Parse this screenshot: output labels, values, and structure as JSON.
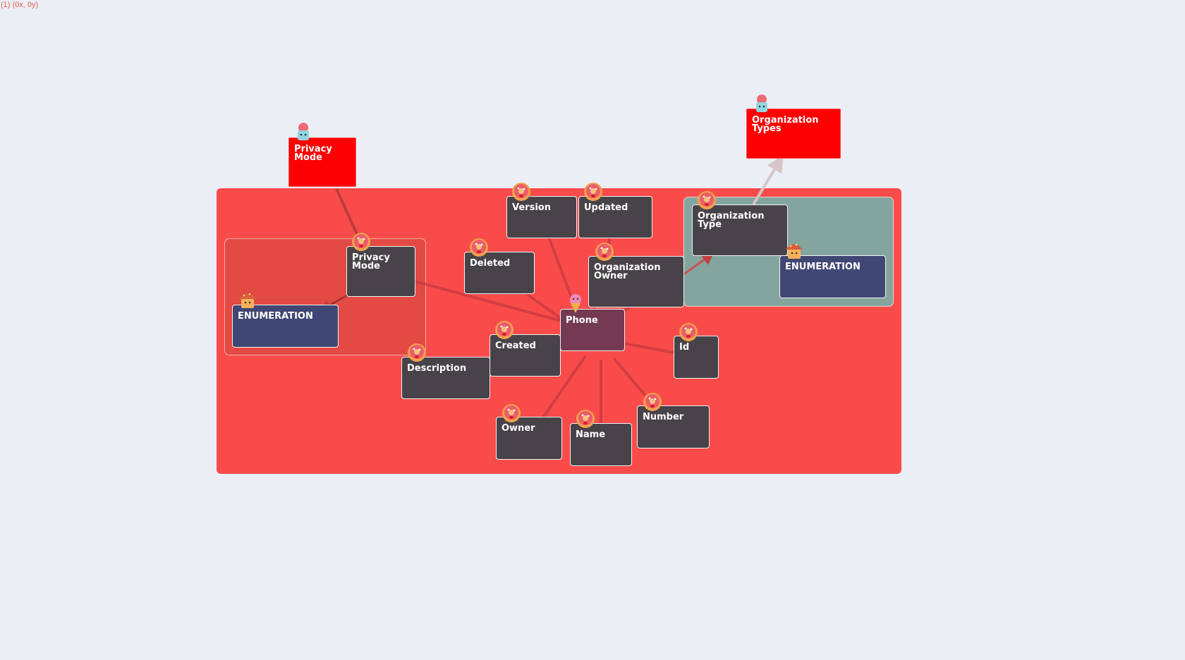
{
  "coords_readout": "(1) (0x, 0y)",
  "groups": {
    "main": "model-group",
    "privacy": "privacy-mode-enum-group",
    "org": "organization-type-enum-group"
  },
  "nodes": {
    "privacy_mode_ext": "Privacy Mode",
    "org_types_ext": "Organization Types",
    "version": "Version",
    "updated": "Updated",
    "deleted": "Deleted",
    "org_owner": "Organization Owner",
    "org_type": "Organization Type",
    "enum_org": "ENUMERATION",
    "privacy_mode": "Privacy Mode",
    "enum_privacy": "ENUMERATION",
    "phone": "Phone",
    "created": "Created",
    "description": "Description",
    "id": "Id",
    "owner": "Owner",
    "name": "Name",
    "number": "Number"
  },
  "icons": {
    "donut": "donut-icon",
    "cupcake": "cupcake-icon",
    "icecream": "ice-cream-icon",
    "muffin": "muffin-icon"
  },
  "colors": {
    "background": "#ebeff5",
    "main_group": "#fa4b4b",
    "privacy_group": "#e34a43",
    "org_group": "#84a59e",
    "entity": "#484349",
    "enum": "#414774",
    "external": "#fd0000",
    "center": "#743a52"
  }
}
